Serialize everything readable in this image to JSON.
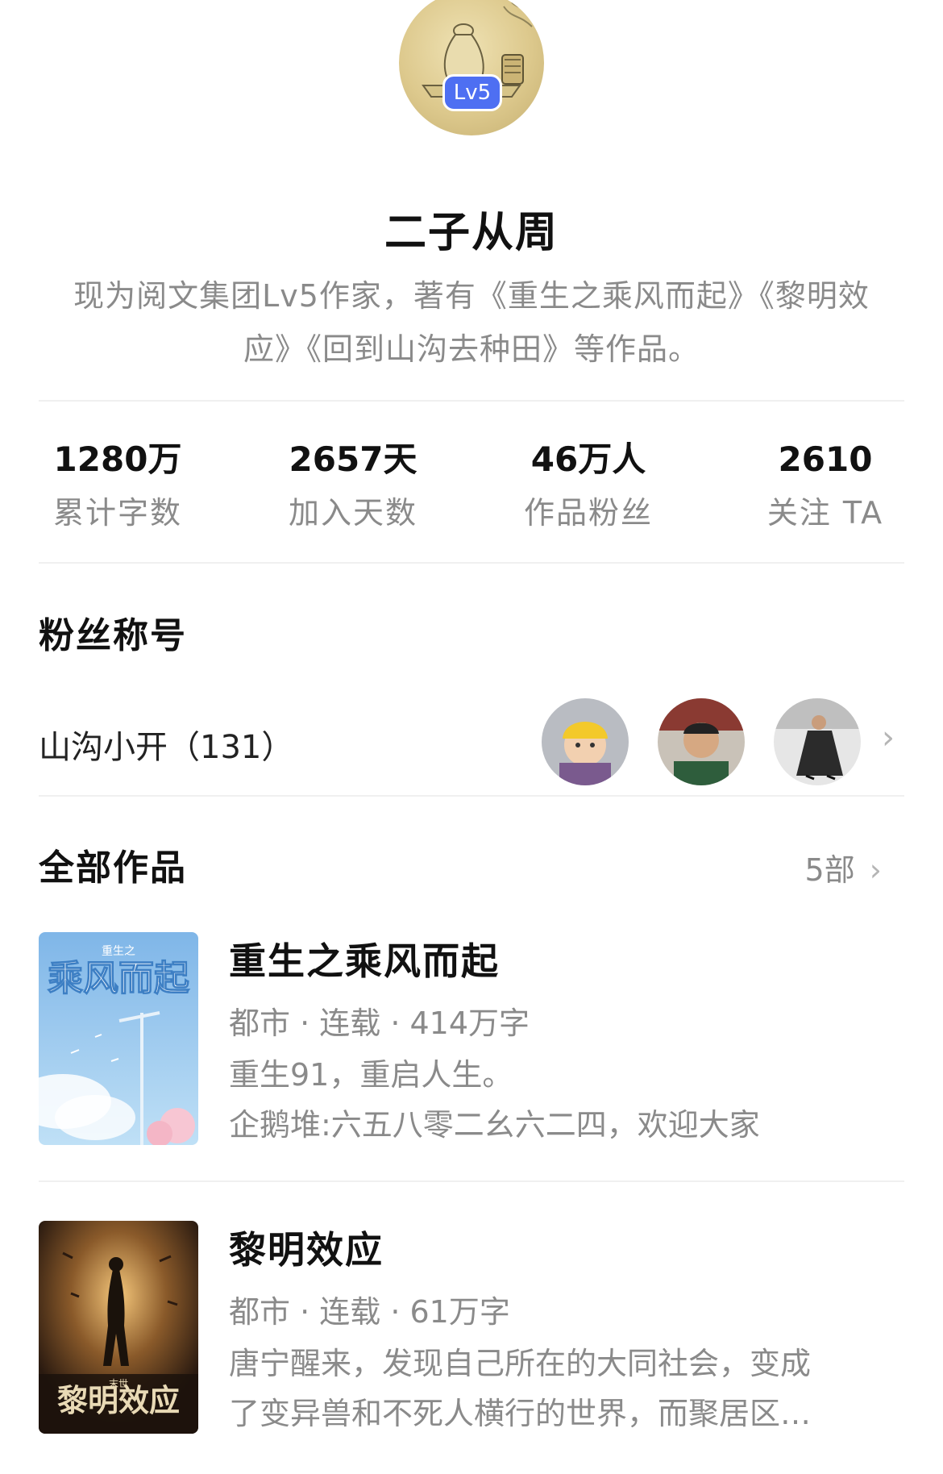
{
  "profile": {
    "level_badge": "Lv5",
    "name": "二子从周",
    "bio": "现为阅文集团Lv5作家，著有《重生之乘风而起》《黎明效应》《回到山沟去种田》等作品。"
  },
  "stats": [
    {
      "value": "1280万",
      "label": "累计字数"
    },
    {
      "value": "2657天",
      "label": "加入天数"
    },
    {
      "value": "46万人",
      "label": "作品粉丝"
    },
    {
      "value": "2610",
      "label": "关注 TA"
    }
  ],
  "fan_section": {
    "title": "粉丝称号",
    "fan_title": "山沟小开（131）"
  },
  "works_section": {
    "title": "全部作品",
    "count": "5部"
  },
  "books": [
    {
      "title": "重生之乘风而起",
      "meta": "都市 · 连载 · 414万字",
      "desc_line1": "重生91，重启人生。",
      "desc_line2": "企鹅堆:六五八零二幺六二四，欢迎大家",
      "cover_text": "乘风而起",
      "cover_small": "重生之"
    },
    {
      "title": "黎明效应",
      "meta": "都市 · 连载 · 61万字",
      "desc_line1": "唐宁醒来，发现自己所在的大同社会，变成",
      "desc_line2": "了变异兽和不死人横行的世界，而聚居区…",
      "cover_text": "黎明效应",
      "cover_small": "末世"
    }
  ],
  "icons": {
    "chevron": "chevron-right-icon"
  }
}
